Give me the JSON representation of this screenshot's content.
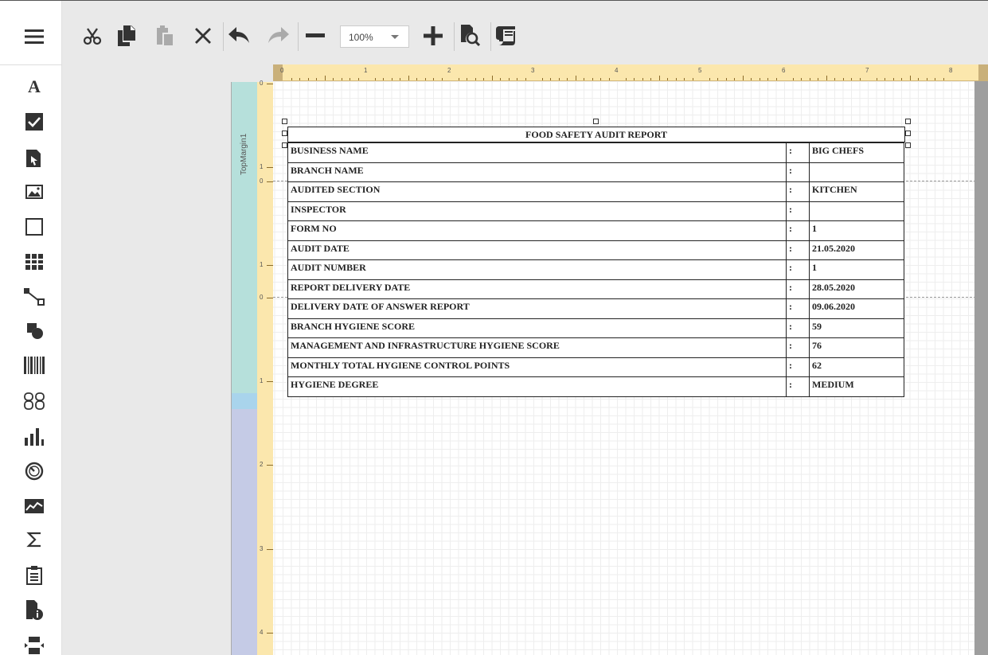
{
  "toolbar": {
    "zoom_value": "100%"
  },
  "band": {
    "label": "TopMargin1"
  },
  "ruler": {
    "h_marks": [
      "0",
      "1",
      "2",
      "3",
      "4",
      "5",
      "6",
      "7",
      "8"
    ],
    "v_marks": [
      "0",
      "1",
      "0",
      "1",
      "0",
      "1",
      "2",
      "3",
      "4"
    ]
  },
  "report": {
    "title": "FOOD SAFETY AUDIT REPORT",
    "rows": [
      {
        "label": "BUSINESS NAME",
        "sep": ":",
        "value": "BIG CHEFS"
      },
      {
        "label": "BRANCH NAME",
        "sep": ":",
        "value": ""
      },
      {
        "label": "AUDITED SECTION",
        "sep": ":",
        "value": "KITCHEN"
      },
      {
        "label": "INSPECTOR",
        "sep": ":",
        "value": ""
      },
      {
        "label": "FORM NO",
        "sep": ":",
        "value": "1"
      },
      {
        "label": "AUDIT DATE",
        "sep": ":",
        "value": "21.05.2020"
      },
      {
        "label": "AUDIT NUMBER",
        "sep": ":",
        "value": "1"
      },
      {
        "label": "REPORT DELIVERY DATE",
        "sep": ":",
        "value": "28.05.2020"
      },
      {
        "label": "DELIVERY DATE OF ANSWER REPORT",
        "sep": ":",
        "value": "09.06.2020"
      },
      {
        "label": "BRANCH HYGIENE SCORE",
        "sep": ":",
        "value": "59"
      },
      {
        "label": "MANAGEMENT AND INFRASTRUCTURE HYGIENE SCORE",
        "sep": ":",
        "value": "76"
      },
      {
        "label": "MONTHLY TOTAL HYGIENE CONTROL POINTS",
        "sep": ":",
        "value": "62"
      },
      {
        "label": "HYGIENE DEGREE",
        "sep": ":",
        "value": "MEDIUM"
      }
    ]
  },
  "sidebar_icons": [
    "menu-icon",
    "text-label-icon",
    "checkbox-icon",
    "rich-text-icon",
    "picture-box-icon",
    "panel-icon",
    "table-icon",
    "line-icon",
    "shape-icon",
    "barcode-icon",
    "character-comb-icon",
    "chart-icon",
    "gauge-icon",
    "sparkline-icon",
    "summary-icon",
    "subreport-icon",
    "page-info-icon",
    "page-break-icon"
  ],
  "toolbar_icons": [
    "cut-icon",
    "copy-icon",
    "paste-icon",
    "delete-icon",
    "undo-icon",
    "redo-icon",
    "zoom-out-icon",
    "zoom-in-icon",
    "preview-icon",
    "script-icon"
  ],
  "colors": {
    "accent": "#333333",
    "ruler": "#fbe7ad",
    "band_top": "#b6e0db",
    "band_body": "#c5cbe6"
  }
}
